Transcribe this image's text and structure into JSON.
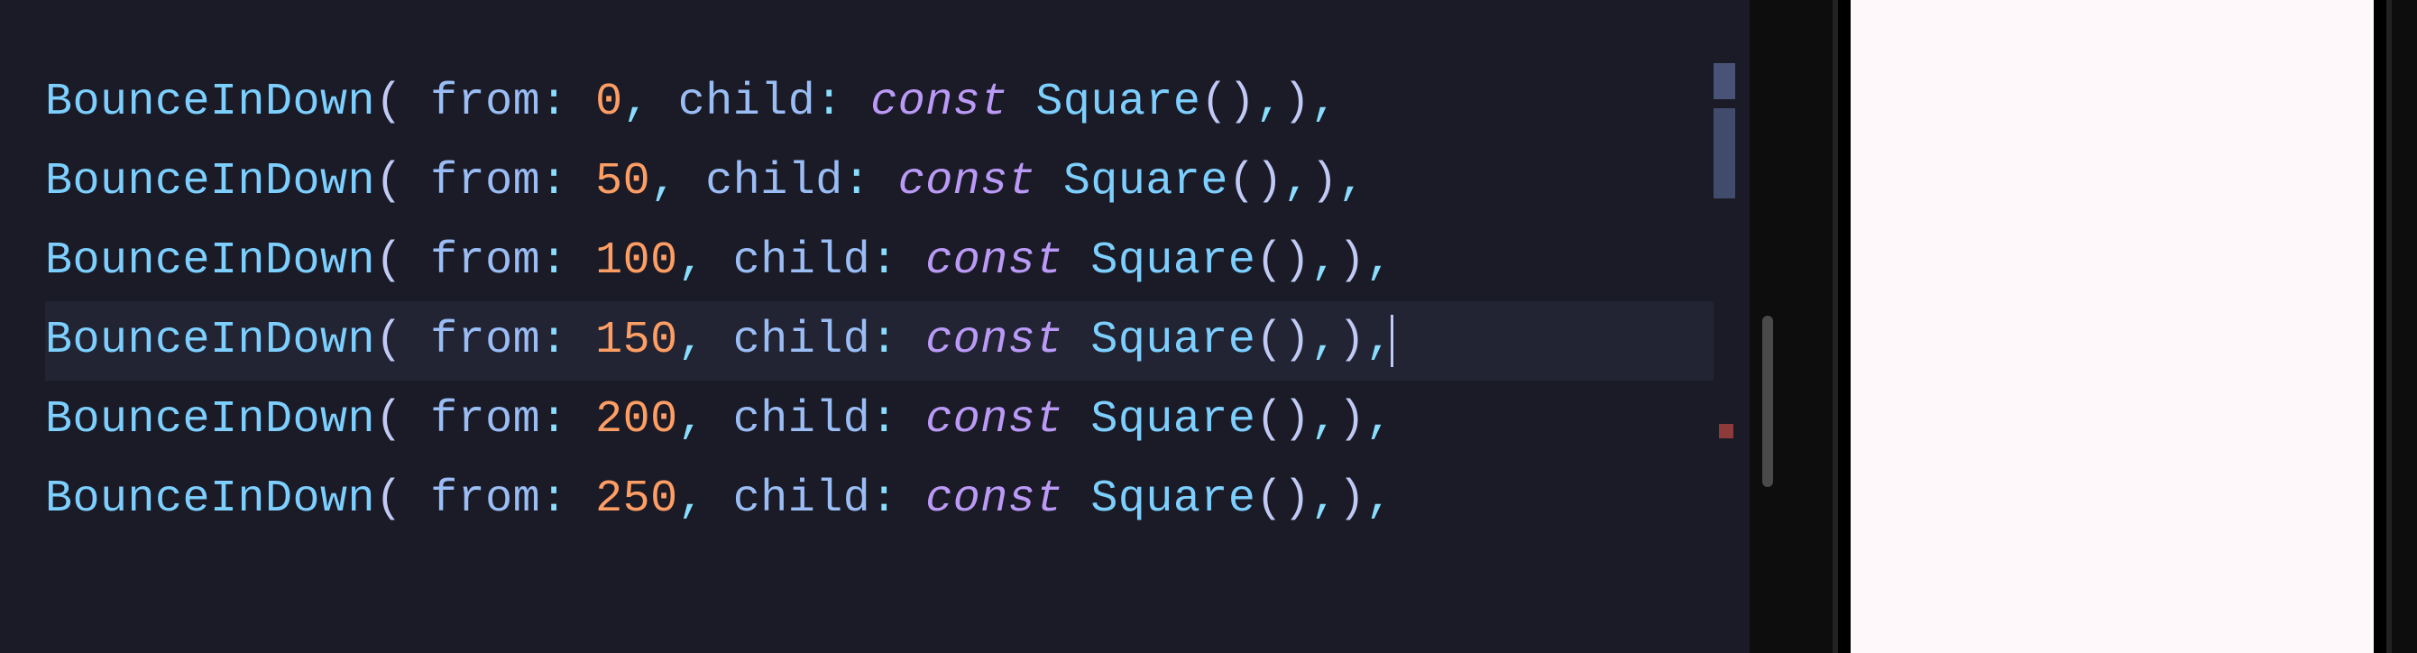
{
  "editor": {
    "lines": [
      {
        "class": "BounceInDown",
        "param_from": "from",
        "from_value": "0",
        "param_child": "child",
        "const_kw": "const",
        "child_type": "Square"
      },
      {
        "class": "BounceInDown",
        "param_from": "from",
        "from_value": "50",
        "param_child": "child",
        "const_kw": "const",
        "child_type": "Square"
      },
      {
        "class": "BounceInDown",
        "param_from": "from",
        "from_value": "100",
        "param_child": "child",
        "const_kw": "const",
        "child_type": "Square"
      },
      {
        "class": "BounceInDown",
        "param_from": "from",
        "from_value": "150",
        "param_child": "child",
        "const_kw": "const",
        "child_type": "Square"
      },
      {
        "class": "BounceInDown",
        "param_from": "from",
        "from_value": "200",
        "param_child": "child",
        "const_kw": "const",
        "child_type": "Square"
      },
      {
        "class": "BounceInDown",
        "param_from": "from",
        "from_value": "250",
        "param_child": "child",
        "const_kw": "const",
        "child_type": "Square"
      }
    ],
    "highlighted_index": 3,
    "cursor_index": 3
  },
  "colors": {
    "background": "#1a1b26",
    "class": "#7dcfff",
    "param": "#9abdf5",
    "number": "#ff9e64",
    "keyword": "#bb9af7",
    "punct": "#89ddff",
    "device_screen": "#fff8fb"
  }
}
